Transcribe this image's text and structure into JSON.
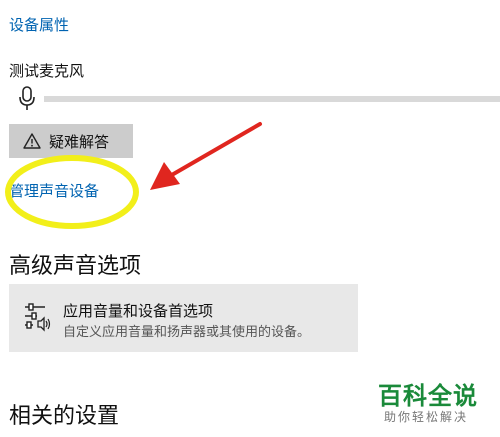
{
  "links": {
    "device_properties": "设备属性",
    "manage_sound_devices": "管理声音设备"
  },
  "mic": {
    "label": "测试麦克风",
    "level_fraction": 0
  },
  "buttons": {
    "troubleshoot": "疑难解答"
  },
  "advanced": {
    "title": "高级声音选项",
    "app_card_title": "应用音量和设备首选项",
    "app_card_desc": "自定义应用音量和扬声器或其使用的设备。"
  },
  "related": {
    "title": "相关的设置"
  },
  "watermark": {
    "title": "百科全说",
    "subtitle": "助你轻松解决"
  },
  "colors": {
    "link": "#0063b1",
    "annotation_yellow": "#f2ef1a",
    "annotation_red": "#e0261f",
    "watermark_green": "#1a8a3a"
  },
  "icons": [
    "microphone-icon",
    "warning-icon",
    "app-volume-icon"
  ]
}
